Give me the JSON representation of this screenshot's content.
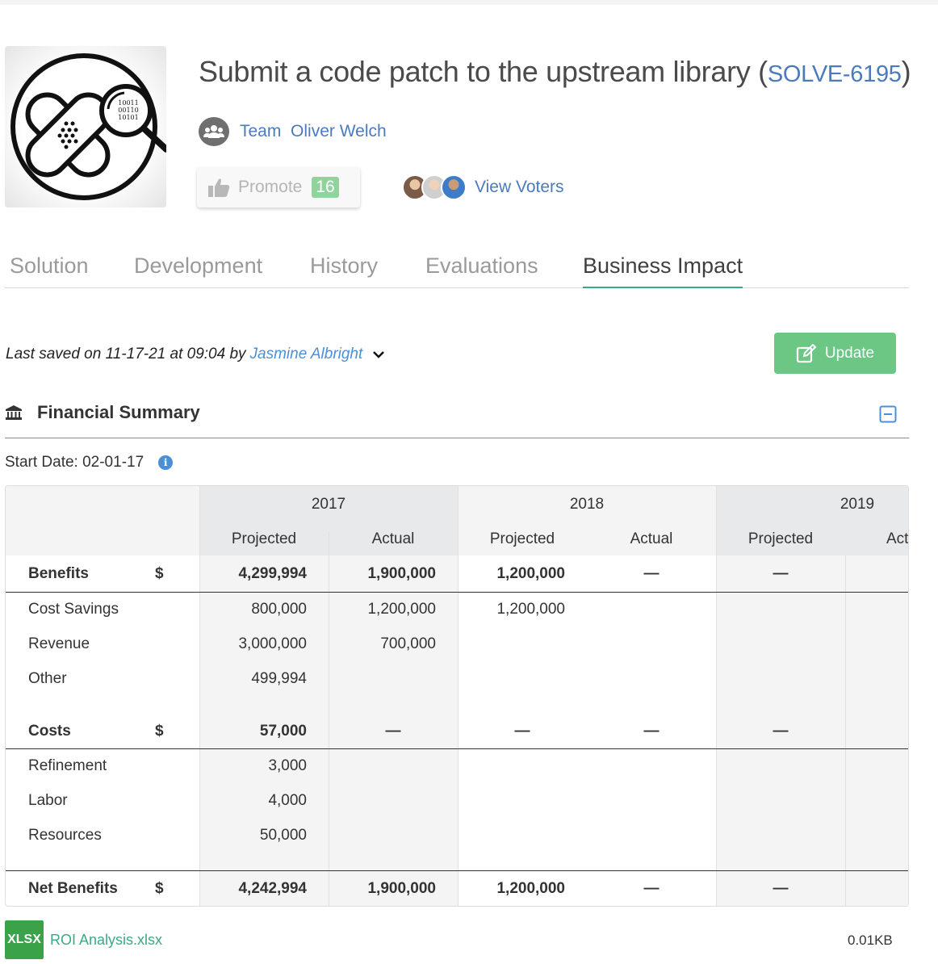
{
  "header": {
    "title": "Submit a code patch to the upstream library",
    "solution_id": "SOLVE-6195",
    "team_label": "Team",
    "team_name": "Oliver Welch",
    "promote_label": "Promote",
    "promote_count": "16",
    "view_voters_label": "View Voters",
    "logo_binary": [
      "10011",
      "00110",
      "10101"
    ]
  },
  "tabs": [
    {
      "label": "Solution",
      "active": false
    },
    {
      "label": "Development",
      "active": false
    },
    {
      "label": "History",
      "active": false
    },
    {
      "label": "Evaluations",
      "active": false
    },
    {
      "label": "Business Impact",
      "active": true
    }
  ],
  "save_info": {
    "prefix": "Last saved on 11-17-21 at 09:04 by",
    "user": "Jasmine Albright"
  },
  "update_button": {
    "label": "Update"
  },
  "financial_summary": {
    "title": "Financial Summary",
    "start_date": "Start Date: 02-01-17",
    "info_icon_glyph": "i",
    "currency": "$",
    "years": [
      "2017",
      "2018",
      "2019"
    ],
    "sub_headers": {
      "projected": "Projected",
      "actual": "Act",
      "actual_full": "Actual"
    },
    "rows": {
      "benefits": {
        "label": "Benefits",
        "values": [
          "4,299,994",
          "1,900,000",
          "1,200,000",
          "—",
          "—"
        ]
      },
      "cost_savings": {
        "label": "Cost Savings",
        "values": [
          "800,000",
          "1,200,000",
          "1,200,000"
        ]
      },
      "revenue": {
        "label": "Revenue",
        "values": [
          "3,000,000",
          "700,000"
        ]
      },
      "other": {
        "label": "Other",
        "values": [
          "499,994"
        ]
      },
      "costs": {
        "label": "Costs",
        "values": [
          "57,000",
          "—",
          "—",
          "—",
          "—"
        ]
      },
      "refinement": {
        "label": "Refinement",
        "values": [
          "3,000"
        ]
      },
      "labor": {
        "label": "Labor",
        "values": [
          "4,000"
        ]
      },
      "resources": {
        "label": "Resources",
        "values": [
          "50,000"
        ]
      },
      "net_benefits": {
        "label": "Net Benefits",
        "values": [
          "4,242,994",
          "1,900,000",
          "1,200,000",
          "—",
          "—"
        ]
      }
    }
  },
  "attachment": {
    "type_label": "XLSX",
    "file_name": "ROI Analysis.xlsx",
    "file_size": "0.01KB"
  },
  "colors": {
    "link": "#4a7bbf",
    "accent_green": "#6cc785",
    "tab_underline": "#3aa986",
    "promote_badge": "#8fd49a"
  }
}
